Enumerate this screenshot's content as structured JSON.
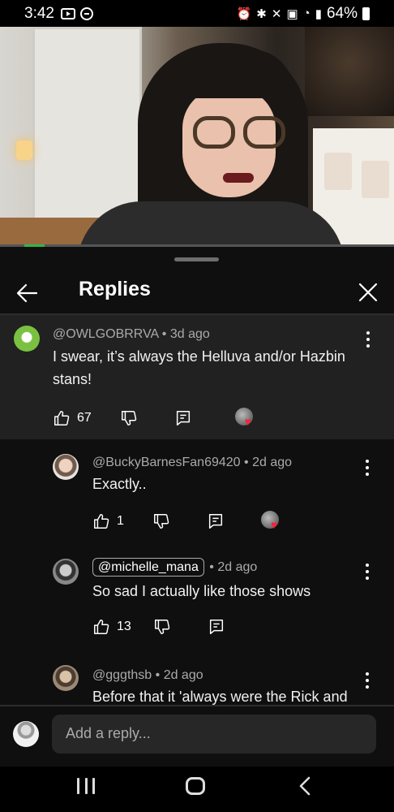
{
  "status_bar": {
    "time": "3:42",
    "battery": "64%"
  },
  "replies_panel": {
    "title": "Replies"
  },
  "parent_comment": {
    "author": "@OWLGOBRRVA",
    "age": "3d ago",
    "text": "I swear, it’s always the Helluva and/or Hazbin stans!",
    "likes": "67"
  },
  "replies": [
    {
      "author": "@BuckyBarnesFan69420",
      "age": "2d ago",
      "text": "Exactly..",
      "likes": "1"
    },
    {
      "author": "",
      "mention": "@michelle_mana",
      "age": "2d ago",
      "text": "So sad I actually like those shows",
      "likes": "13"
    },
    {
      "author": "@gggthsb",
      "age": "2d ago",
      "text": "Before that it 'always were the Rick and"
    }
  ],
  "reply_input": {
    "placeholder": "Add a reply..."
  },
  "colors": {
    "background": "#0f0f0f",
    "highlight": "#212121",
    "heart": "#ff1f3d",
    "progress": "#2fb54a"
  }
}
